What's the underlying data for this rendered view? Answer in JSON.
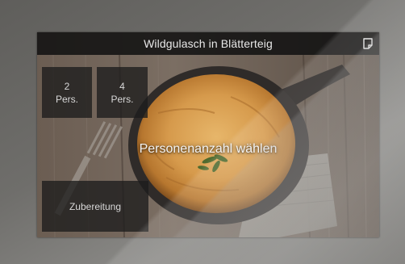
{
  "header": {
    "title": "Wildgulasch in Blätterteig",
    "action_icon": "document-icon"
  },
  "servings": [
    {
      "number": "2",
      "unit": "Pers."
    },
    {
      "number": "4",
      "unit": "Pers."
    }
  ],
  "prompt": "Personenanzahl wählen",
  "preparation_button": "Zubereitung",
  "colors": {
    "titlebar": "#121212",
    "tile": "#1c1c1c",
    "text": "#e8e8e8"
  }
}
